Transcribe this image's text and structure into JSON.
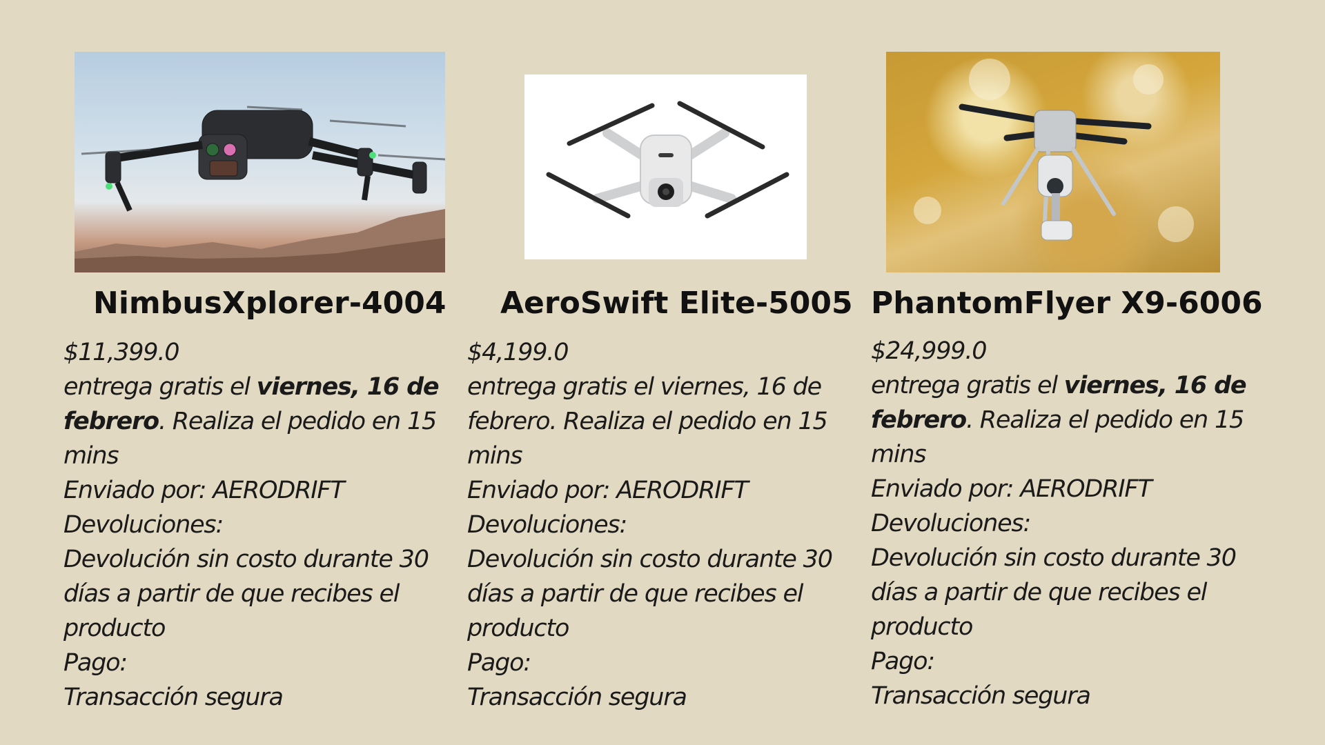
{
  "products": [
    {
      "name": "NimbusXplorer-4004",
      "price": "$11,399.0",
      "delivery_prefix": "entrega gratis el ",
      "delivery_date": "viernes, 16 de febrero",
      "delivery_suffix": ". Realiza el pedido en 15 mins",
      "shipped_by": "Enviado por: AERODRIFT",
      "returns_label": "Devoluciones:",
      "returns_text": "Devolución sin costo durante 30 días a partir de que recibes el producto",
      "payment_label": "Pago:",
      "payment_text": "Transacción segura",
      "image_icon": "drone-photo-sky"
    },
    {
      "name": "AeroSwift Elite-5005",
      "price": "$4,199.0",
      "delivery_prefix": "entrega gratis el ",
      "delivery_date": "viernes, 16 de febrero",
      "delivery_suffix": ". Realiza el pedido en 15 mins",
      "shipped_by": "Enviado por: AERODRIFT",
      "returns_label": "Devoluciones:",
      "returns_text": "Devolución sin costo durante 30 días a partir de que recibes el producto",
      "payment_label": "Pago:",
      "payment_text": "Transacción segura",
      "image_icon": "drone-photo-white"
    },
    {
      "name": "PhantomFlyer X9-6006",
      "price": "$24,999.0",
      "delivery_prefix": "entrega gratis el ",
      "delivery_date": "viernes, 16 de febrero",
      "delivery_suffix": ". Realiza el pedido en 15 mins",
      "shipped_by": "Enviado por: AERODRIFT",
      "returns_label": "Devoluciones:",
      "returns_text": "Devolución sin costo durante 30 días a partir de que recibes el producto",
      "payment_label": "Pago:",
      "payment_text": "Transacción segura",
      "image_icon": "drone-photo-foliage"
    }
  ],
  "colors": {
    "background": "#e2d9c3",
    "text": "#141414"
  }
}
